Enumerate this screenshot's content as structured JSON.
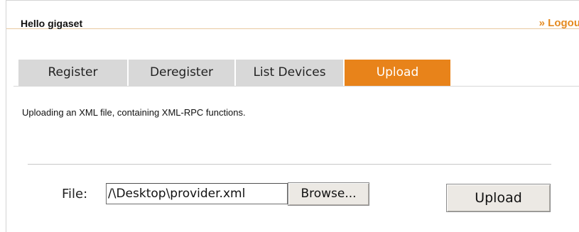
{
  "header": {
    "greeting": "Hello gigaset",
    "logout_label": "» Logout"
  },
  "tabs": [
    {
      "label": "Register",
      "active": false
    },
    {
      "label": "Deregister",
      "active": false
    },
    {
      "label": "List Devices",
      "active": false
    },
    {
      "label": "Upload",
      "active": true
    }
  ],
  "content": {
    "description": "Uploading an XML file, containing XML-RPC functions."
  },
  "form": {
    "file_label": "File:",
    "file_value": "/\\Desktop\\provider.xml",
    "browse_label": "Browse...",
    "upload_label": "Upload"
  },
  "colors": {
    "accent": "#e8831a",
    "tab_inactive": "#d8d8d8"
  }
}
